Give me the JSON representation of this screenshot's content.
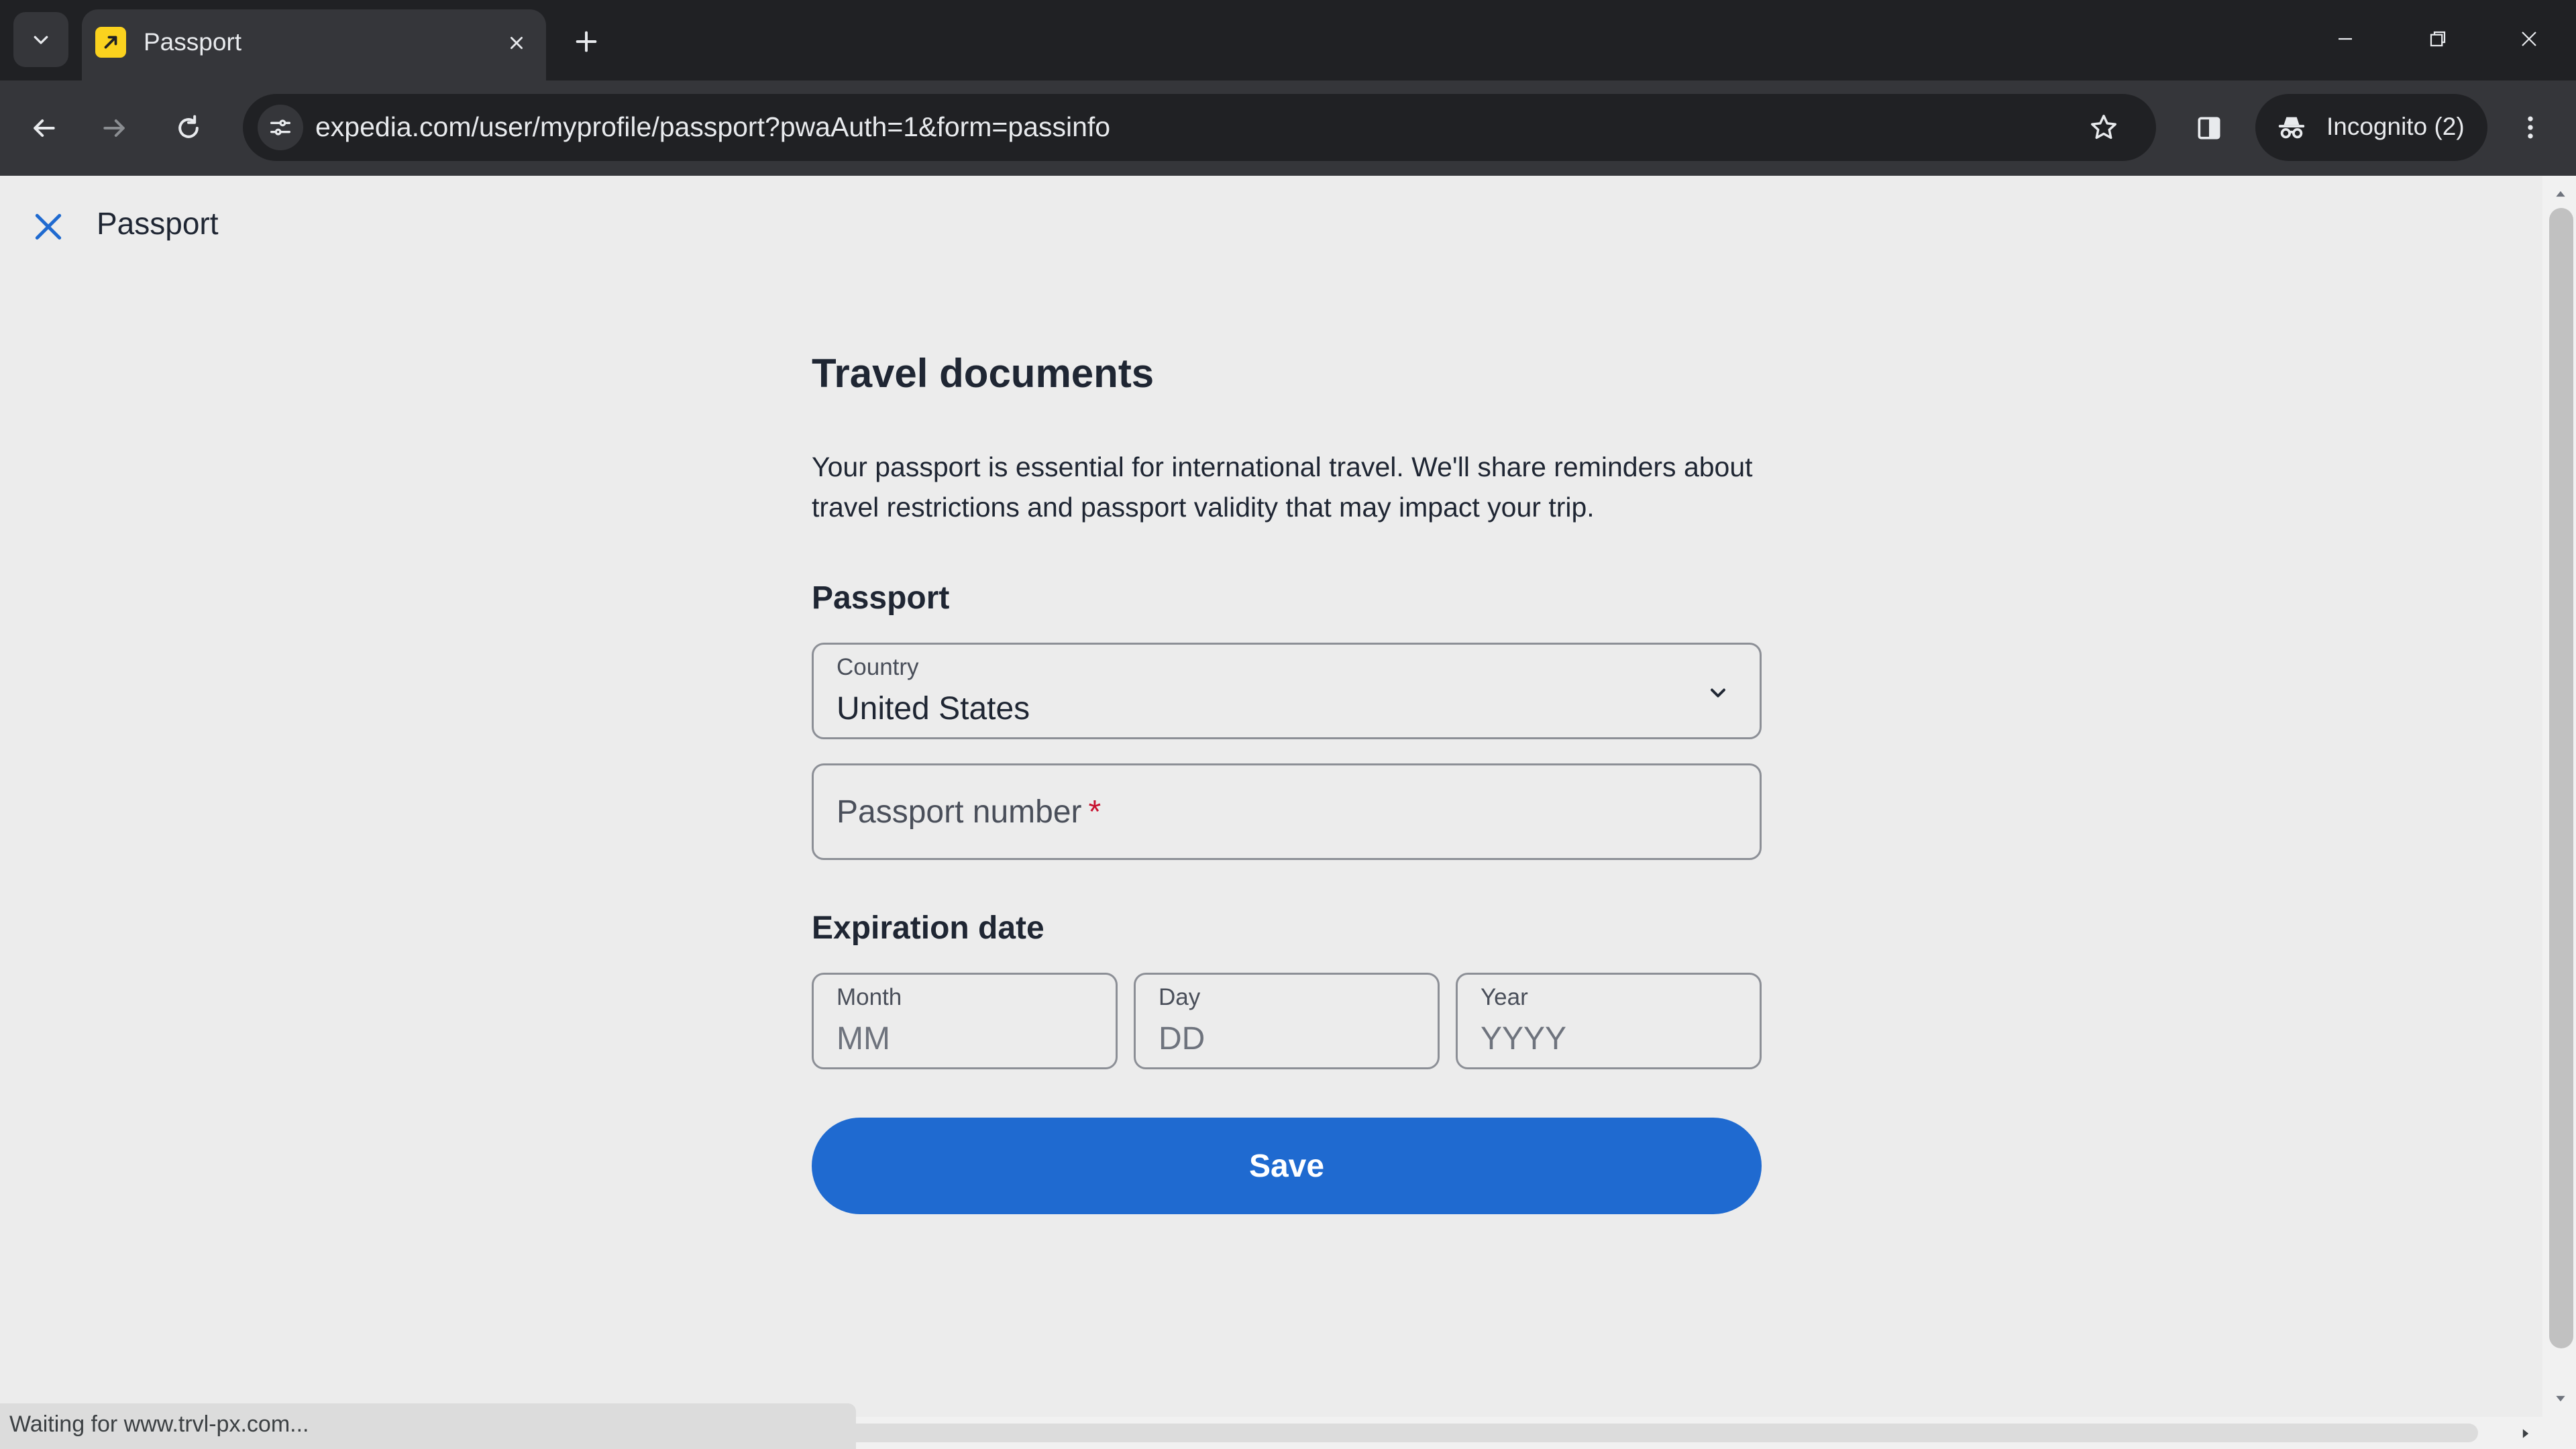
{
  "browser": {
    "tab_title": "Passport",
    "url": "expedia.com/user/myprofile/passport?pwaAuth=1&form=passinfo",
    "incognito_label": "Incognito (2)",
    "status_text": "Waiting for www.trvl-px.com..."
  },
  "page": {
    "header_title": "Passport",
    "heading": "Travel documents",
    "description": "Your passport is essential for international travel. We'll share reminders about travel restrictions and passport validity that may impact your trip.",
    "passport_section": "Passport",
    "country": {
      "label": "Country",
      "value": "United States"
    },
    "passport_number": {
      "label": "Passport number",
      "required_mark": "*"
    },
    "expiration_section": "Expiration date",
    "month": {
      "label": "Month",
      "placeholder": "MM"
    },
    "day": {
      "label": "Day",
      "placeholder": "DD"
    },
    "year": {
      "label": "Year",
      "placeholder": "YYYY"
    },
    "save_label": "Save"
  },
  "colors": {
    "primary_button": "#1f6ad0",
    "close_icon": "#1f6ad0",
    "required": "#c8102e",
    "favicon": "#fbd21e"
  },
  "icons": {
    "tab_search": "chevron-down-icon",
    "favicon": "expedia-logo-icon",
    "tab_close": "close-icon",
    "new_tab": "plus-icon",
    "back": "arrow-left-icon",
    "forward": "arrow-right-icon",
    "reload": "reload-icon",
    "site_info": "tune-icon",
    "bookmark": "star-icon",
    "side_panel": "side-panel-icon",
    "incognito": "incognito-icon",
    "menu": "kebab-menu-icon",
    "page_close": "close-icon",
    "dropdown": "chevron-down-icon"
  }
}
